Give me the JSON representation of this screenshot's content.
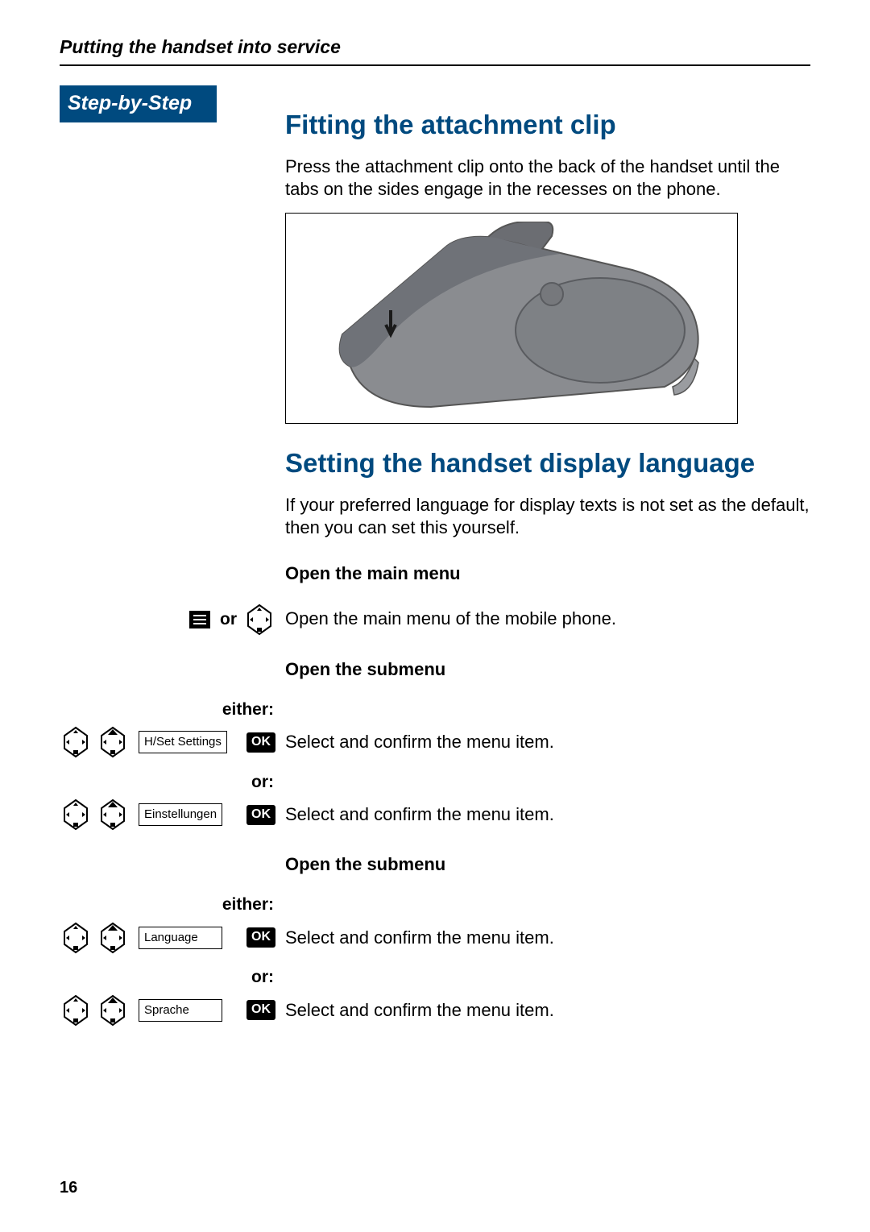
{
  "running_head": "Putting the handset into service",
  "step_badge": "Step-by-Step",
  "section1": {
    "title": "Fitting the attachment clip",
    "body": "Press the attachment clip onto the back of the handset until the tabs on the sides engage in the recesses on the phone."
  },
  "section2": {
    "title": "Setting the handset display language",
    "intro": "If your preferred language for display texts is not set as the default, then you can set this yourself.",
    "sub_open_main": "Open the main menu",
    "open_main_text": "Open the main menu of the mobile phone.",
    "open_main_or": "or",
    "sub_open_submenu_1": "Open the submenu",
    "either_1": "either:",
    "row1_menu": "H/Set Settings",
    "row1_ok": "OK",
    "row1_text": "Select and confirm the menu item.",
    "or_1": "or:",
    "row2_menu": "Einstellungen",
    "row2_ok": "OK",
    "row2_text": "Select and confirm the menu item.",
    "sub_open_submenu_2": "Open the submenu",
    "either_2": "either:",
    "row3_menu": "Language",
    "row3_ok": "OK",
    "row3_text": "Select and confirm the menu item.",
    "or_2": "or:",
    "row4_menu": "Sprache",
    "row4_ok": "OK",
    "row4_text": "Select and confirm the menu item."
  },
  "page_number": "16"
}
